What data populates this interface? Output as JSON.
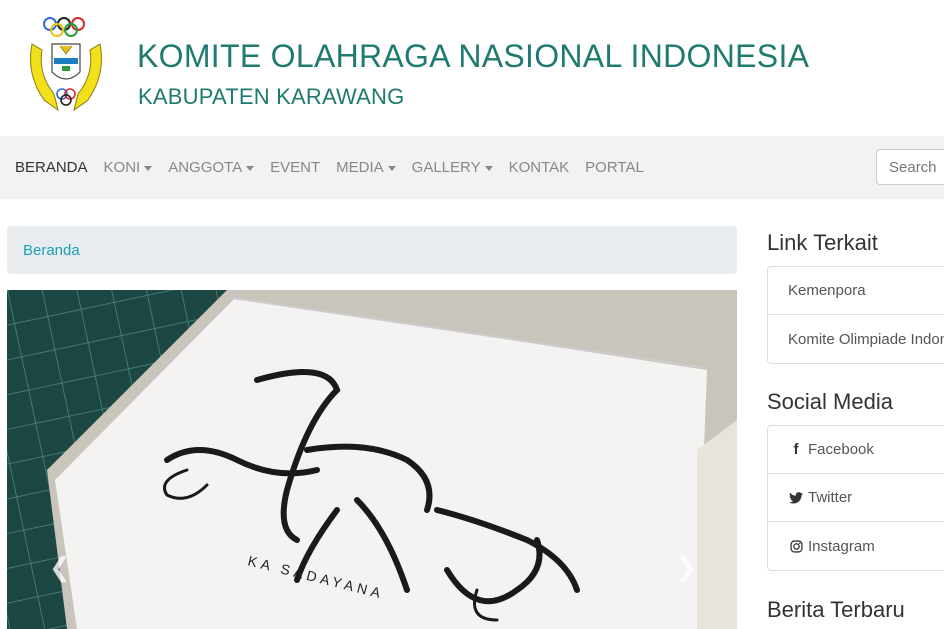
{
  "header": {
    "title": "KOMITE OLAHRAGA NASIONAL INDONESIA",
    "subtitle": "KABUPATEN KARAWANG",
    "logo_icon": "koni-emblem-logo"
  },
  "nav": {
    "items": [
      {
        "label": "BERANDA",
        "dropdown": false,
        "active": true
      },
      {
        "label": "KONI",
        "dropdown": true
      },
      {
        "label": "ANGGOTA",
        "dropdown": true
      },
      {
        "label": "EVENT",
        "dropdown": false
      },
      {
        "label": "MEDIA",
        "dropdown": true
      },
      {
        "label": "GALLERY",
        "dropdown": true
      },
      {
        "label": "KONTAK",
        "dropdown": false
      },
      {
        "label": "PORTAL",
        "dropdown": false
      }
    ],
    "search_placeholder": "Search"
  },
  "breadcrumb": {
    "home": "Beranda"
  },
  "carousel": {
    "image_text_main": "Hatur Nuhun",
    "image_text_sub": "KA SADAYANA",
    "prev_icon": "chevron-left-icon",
    "next_icon": "chevron-right-icon"
  },
  "sidebar": {
    "links_heading": "Link Terkait",
    "links": [
      "Kemenpora",
      "Komite Olimpiade Indonesia"
    ],
    "social_heading": "Social Media",
    "social": [
      {
        "label": "Facebook",
        "icon": "facebook-icon"
      },
      {
        "label": "Twitter",
        "icon": "twitter-icon"
      },
      {
        "label": "Instagram",
        "icon": "instagram-icon"
      }
    ],
    "news_heading": "Berita Terbaru"
  },
  "colors": {
    "brand": "#1f7a6f",
    "link": "#17a2b8",
    "nav_bg": "#f2f2f2",
    "breadcrumb_bg": "#e9ecef"
  }
}
